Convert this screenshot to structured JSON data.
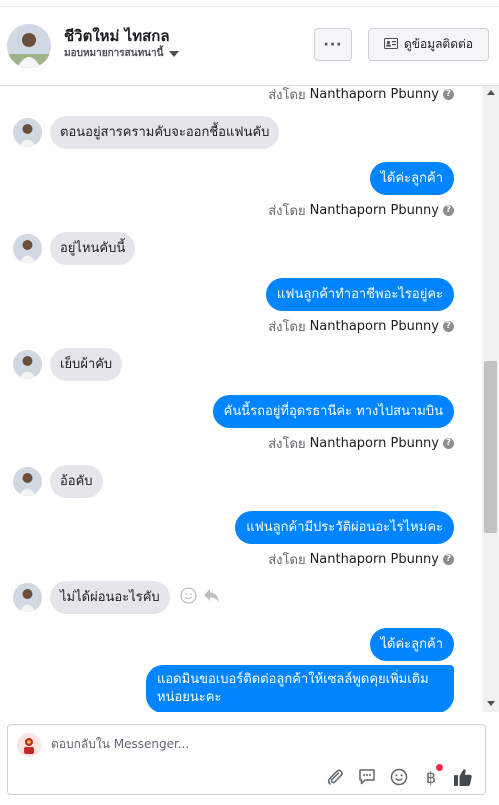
{
  "header": {
    "name": "ชีวิตใหม่ ไทสกล",
    "assign_label": "มอบหมายการสนทนานี้",
    "more_label": "···",
    "contact_button": "ดูข้อมูลติดต่อ"
  },
  "thread": {
    "sent_by_prefix": "ส่งโดย",
    "sent_by_name": "Nanthaporn Pbunny",
    "messages": [
      {
        "from": "page",
        "text": "",
        "sent_by": true
      },
      {
        "from": "customer",
        "text": "ตอนอยู่สารครามคับจะออกชื้อแฟนคับ"
      },
      {
        "from": "page",
        "text": "ได้ค่ะลูกค้า",
        "sent_by": true
      },
      {
        "from": "customer",
        "text": "อยู่ไหนคับนี้"
      },
      {
        "from": "page",
        "text": "แฟนลูกค้าทำอาชีพอะไรอยู่คะ",
        "sent_by": true
      },
      {
        "from": "customer",
        "text": "เย็บผ้าคับ"
      },
      {
        "from": "page",
        "text": "คันนี้รถอยู่ที่อุดรธานีค่ะ ทางไปสนามบิน",
        "sent_by": true
      },
      {
        "from": "customer",
        "text": "อ้อคับ"
      },
      {
        "from": "page",
        "text": "แฟนลูกค้ามีประวัติผ่อนอะไรไหมคะ",
        "sent_by": true
      },
      {
        "from": "customer",
        "text": "ไม่ได้ผ่อนอะไรคับ"
      },
      {
        "from": "page",
        "text": "ได้ค่ะลูกค้า"
      },
      {
        "from": "page",
        "text": "แอดมินขอเบอร์ติดต่อลูกค้าให้เซลล์พูดคุยเพิ่มเติมหน่อยนะคะ"
      }
    ]
  },
  "composer": {
    "placeholder": "ตอบกลับใน Messenger..."
  },
  "icons": {
    "attach": "paperclip-icon",
    "saved_replies": "chat-bubble-icon",
    "emoji": "smiley-icon",
    "payment": "baht-icon",
    "like": "thumbs-up-icon"
  },
  "colors": {
    "outgoing_bubble": "#0084ff",
    "incoming_bubble": "#e4e6eb",
    "notification_dot": "#f02849"
  }
}
